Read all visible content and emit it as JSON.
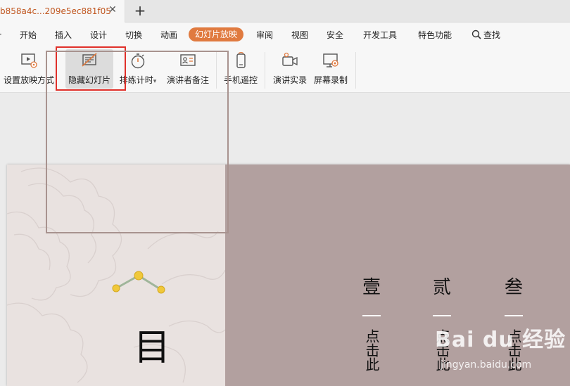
{
  "tab": {
    "title": "b858a4c...209e5ec881f05",
    "close": "✕",
    "new_tab": "+"
  },
  "menu": {
    "items": [
      "开始",
      "插入",
      "设计",
      "切换",
      "动画",
      "幻灯片放映",
      "审阅",
      "视图",
      "安全",
      "开发工具",
      "特色功能"
    ],
    "active": "幻灯片放映",
    "search": "查找"
  },
  "toolbar": {
    "buttons": [
      {
        "label": "设置放映方式",
        "icon": "slideshow-settings-icon"
      },
      {
        "label": "隐藏幻灯片",
        "icon": "hide-slide-icon",
        "pressed": true
      },
      {
        "label": "排练计时",
        "icon": "stopwatch-icon"
      },
      {
        "label": "演讲者备注",
        "icon": "speaker-notes-icon"
      },
      {
        "label": "手机遥控",
        "icon": "phone-remote-icon"
      },
      {
        "label": "演讲实录",
        "icon": "record-camera-icon"
      },
      {
        "label": "屏幕录制",
        "icon": "screen-record-icon"
      }
    ],
    "dropdown_marker": "▾"
  },
  "slide": {
    "big_char": "目",
    "columns": [
      {
        "head": "壹",
        "body": "点击此"
      },
      {
        "head": "贰",
        "body": "点击此"
      },
      {
        "head": "叁",
        "body": "点击此"
      }
    ]
  },
  "watermark": {
    "logo": "Bai du 经验",
    "sub": "jingyan.baidu.com"
  },
  "colors": {
    "accent": "#e07a3f",
    "highlight": "#e0302a",
    "slide_right": "#b2a09f",
    "slide_left": "#e9e2e0"
  }
}
